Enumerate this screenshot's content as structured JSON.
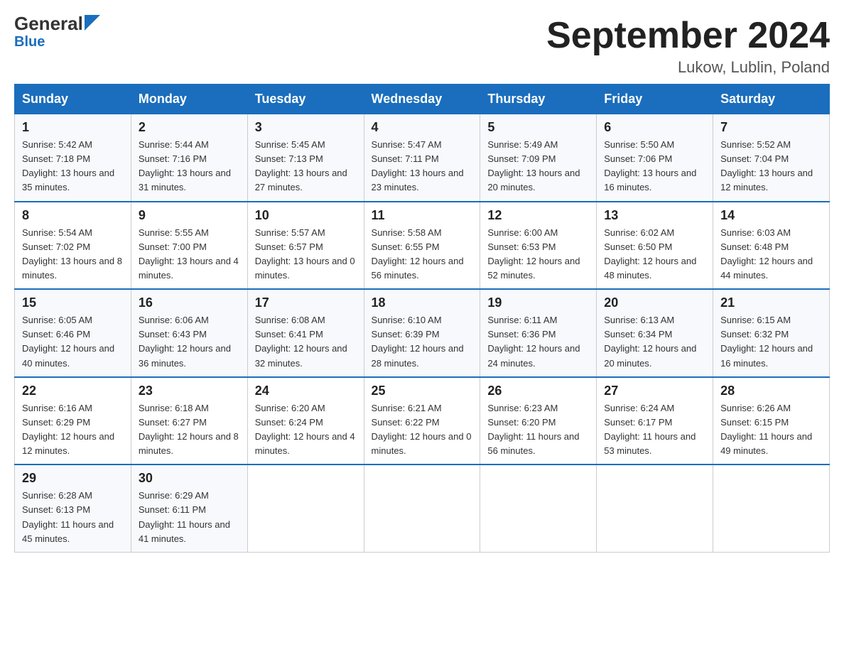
{
  "header": {
    "logo_general": "General",
    "logo_blue": "Blue",
    "month_title": "September 2024",
    "location": "Lukow, Lublin, Poland"
  },
  "days_of_week": [
    "Sunday",
    "Monday",
    "Tuesday",
    "Wednesday",
    "Thursday",
    "Friday",
    "Saturday"
  ],
  "weeks": [
    [
      {
        "day": "1",
        "sunrise": "Sunrise: 5:42 AM",
        "sunset": "Sunset: 7:18 PM",
        "daylight": "Daylight: 13 hours and 35 minutes."
      },
      {
        "day": "2",
        "sunrise": "Sunrise: 5:44 AM",
        "sunset": "Sunset: 7:16 PM",
        "daylight": "Daylight: 13 hours and 31 minutes."
      },
      {
        "day": "3",
        "sunrise": "Sunrise: 5:45 AM",
        "sunset": "Sunset: 7:13 PM",
        "daylight": "Daylight: 13 hours and 27 minutes."
      },
      {
        "day": "4",
        "sunrise": "Sunrise: 5:47 AM",
        "sunset": "Sunset: 7:11 PM",
        "daylight": "Daylight: 13 hours and 23 minutes."
      },
      {
        "day": "5",
        "sunrise": "Sunrise: 5:49 AM",
        "sunset": "Sunset: 7:09 PM",
        "daylight": "Daylight: 13 hours and 20 minutes."
      },
      {
        "day": "6",
        "sunrise": "Sunrise: 5:50 AM",
        "sunset": "Sunset: 7:06 PM",
        "daylight": "Daylight: 13 hours and 16 minutes."
      },
      {
        "day": "7",
        "sunrise": "Sunrise: 5:52 AM",
        "sunset": "Sunset: 7:04 PM",
        "daylight": "Daylight: 13 hours and 12 minutes."
      }
    ],
    [
      {
        "day": "8",
        "sunrise": "Sunrise: 5:54 AM",
        "sunset": "Sunset: 7:02 PM",
        "daylight": "Daylight: 13 hours and 8 minutes."
      },
      {
        "day": "9",
        "sunrise": "Sunrise: 5:55 AM",
        "sunset": "Sunset: 7:00 PM",
        "daylight": "Daylight: 13 hours and 4 minutes."
      },
      {
        "day": "10",
        "sunrise": "Sunrise: 5:57 AM",
        "sunset": "Sunset: 6:57 PM",
        "daylight": "Daylight: 13 hours and 0 minutes."
      },
      {
        "day": "11",
        "sunrise": "Sunrise: 5:58 AM",
        "sunset": "Sunset: 6:55 PM",
        "daylight": "Daylight: 12 hours and 56 minutes."
      },
      {
        "day": "12",
        "sunrise": "Sunrise: 6:00 AM",
        "sunset": "Sunset: 6:53 PM",
        "daylight": "Daylight: 12 hours and 52 minutes."
      },
      {
        "day": "13",
        "sunrise": "Sunrise: 6:02 AM",
        "sunset": "Sunset: 6:50 PM",
        "daylight": "Daylight: 12 hours and 48 minutes."
      },
      {
        "day": "14",
        "sunrise": "Sunrise: 6:03 AM",
        "sunset": "Sunset: 6:48 PM",
        "daylight": "Daylight: 12 hours and 44 minutes."
      }
    ],
    [
      {
        "day": "15",
        "sunrise": "Sunrise: 6:05 AM",
        "sunset": "Sunset: 6:46 PM",
        "daylight": "Daylight: 12 hours and 40 minutes."
      },
      {
        "day": "16",
        "sunrise": "Sunrise: 6:06 AM",
        "sunset": "Sunset: 6:43 PM",
        "daylight": "Daylight: 12 hours and 36 minutes."
      },
      {
        "day": "17",
        "sunrise": "Sunrise: 6:08 AM",
        "sunset": "Sunset: 6:41 PM",
        "daylight": "Daylight: 12 hours and 32 minutes."
      },
      {
        "day": "18",
        "sunrise": "Sunrise: 6:10 AM",
        "sunset": "Sunset: 6:39 PM",
        "daylight": "Daylight: 12 hours and 28 minutes."
      },
      {
        "day": "19",
        "sunrise": "Sunrise: 6:11 AM",
        "sunset": "Sunset: 6:36 PM",
        "daylight": "Daylight: 12 hours and 24 minutes."
      },
      {
        "day": "20",
        "sunrise": "Sunrise: 6:13 AM",
        "sunset": "Sunset: 6:34 PM",
        "daylight": "Daylight: 12 hours and 20 minutes."
      },
      {
        "day": "21",
        "sunrise": "Sunrise: 6:15 AM",
        "sunset": "Sunset: 6:32 PM",
        "daylight": "Daylight: 12 hours and 16 minutes."
      }
    ],
    [
      {
        "day": "22",
        "sunrise": "Sunrise: 6:16 AM",
        "sunset": "Sunset: 6:29 PM",
        "daylight": "Daylight: 12 hours and 12 minutes."
      },
      {
        "day": "23",
        "sunrise": "Sunrise: 6:18 AM",
        "sunset": "Sunset: 6:27 PM",
        "daylight": "Daylight: 12 hours and 8 minutes."
      },
      {
        "day": "24",
        "sunrise": "Sunrise: 6:20 AM",
        "sunset": "Sunset: 6:24 PM",
        "daylight": "Daylight: 12 hours and 4 minutes."
      },
      {
        "day": "25",
        "sunrise": "Sunrise: 6:21 AM",
        "sunset": "Sunset: 6:22 PM",
        "daylight": "Daylight: 12 hours and 0 minutes."
      },
      {
        "day": "26",
        "sunrise": "Sunrise: 6:23 AM",
        "sunset": "Sunset: 6:20 PM",
        "daylight": "Daylight: 11 hours and 56 minutes."
      },
      {
        "day": "27",
        "sunrise": "Sunrise: 6:24 AM",
        "sunset": "Sunset: 6:17 PM",
        "daylight": "Daylight: 11 hours and 53 minutes."
      },
      {
        "day": "28",
        "sunrise": "Sunrise: 6:26 AM",
        "sunset": "Sunset: 6:15 PM",
        "daylight": "Daylight: 11 hours and 49 minutes."
      }
    ],
    [
      {
        "day": "29",
        "sunrise": "Sunrise: 6:28 AM",
        "sunset": "Sunset: 6:13 PM",
        "daylight": "Daylight: 11 hours and 45 minutes."
      },
      {
        "day": "30",
        "sunrise": "Sunrise: 6:29 AM",
        "sunset": "Sunset: 6:11 PM",
        "daylight": "Daylight: 11 hours and 41 minutes."
      },
      null,
      null,
      null,
      null,
      null
    ]
  ]
}
